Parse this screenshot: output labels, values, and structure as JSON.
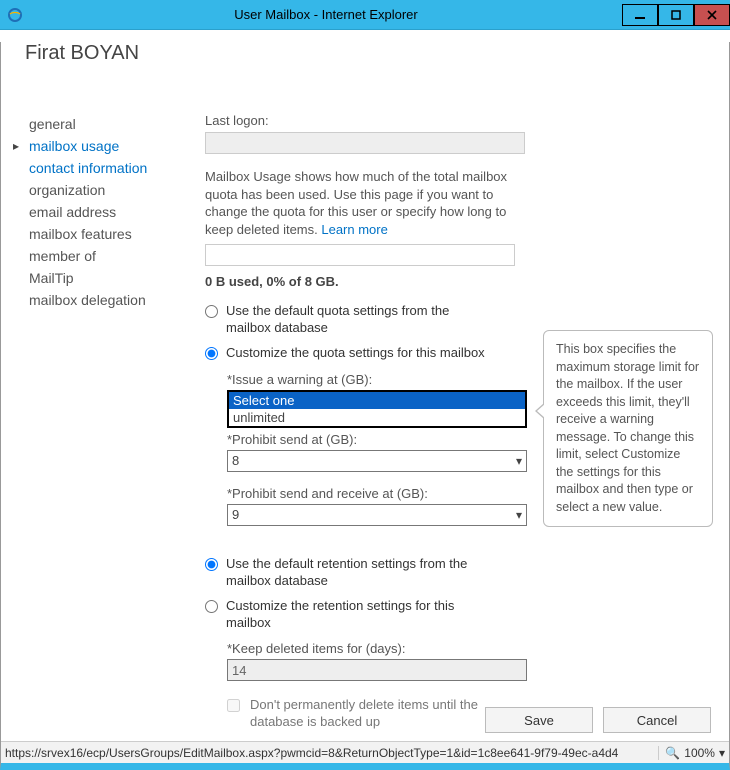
{
  "window": {
    "title": "User Mailbox - Internet Explorer"
  },
  "user": {
    "display_name": "Firat BOYAN"
  },
  "sidebar": {
    "items": [
      {
        "label": "general"
      },
      {
        "label": "mailbox usage"
      },
      {
        "label": "contact information"
      },
      {
        "label": "organization"
      },
      {
        "label": "email address"
      },
      {
        "label": "mailbox features"
      },
      {
        "label": "member of"
      },
      {
        "label": "MailTip"
      },
      {
        "label": "mailbox delegation"
      }
    ]
  },
  "main": {
    "last_logon_label": "Last logon:",
    "last_logon_value": "",
    "description": "Mailbox Usage shows how much of the total mailbox quota has been used. Use this page if you want to change the quota for this user or specify how long to keep deleted items.",
    "learn_more": "Learn more",
    "usage_line": "0 B used, 0% of 8 GB.",
    "quota_default_label": "Use the default quota settings from the mailbox database",
    "quota_custom_label": "Customize the quota settings for this mailbox",
    "warning_label": "*Issue a warning at (GB):",
    "warning_dropdown": {
      "placeholder": "Select one",
      "option": "unlimited"
    },
    "prohibit_send_label": "*Prohibit send at (GB):",
    "prohibit_send_value": "8",
    "prohibit_sr_label": "*Prohibit send and receive at (GB):",
    "prohibit_sr_value": "9",
    "retention_default_label": "Use the default retention settings from the mailbox database",
    "retention_custom_label": "Customize the retention settings for this mailbox",
    "keep_deleted_label": "*Keep deleted items for (days):",
    "keep_deleted_value": "14",
    "no_perm_delete_label": "Don't permanently delete items until the database is backed up"
  },
  "tooltip": {
    "text": "This box specifies the maximum storage limit for the mailbox. If the user exceeds this limit, they'll receive a warning message. To change this limit, select Customize the settings for this mailbox and then type or select a new value."
  },
  "footer": {
    "save": "Save",
    "cancel": "Cancel"
  },
  "statusbar": {
    "url": "https://srvex16/ecp/UsersGroups/EditMailbox.aspx?pwmcid=8&ReturnObjectType=1&id=1c8ee641-9f79-49ec-a4d4",
    "zoom": "100%"
  }
}
